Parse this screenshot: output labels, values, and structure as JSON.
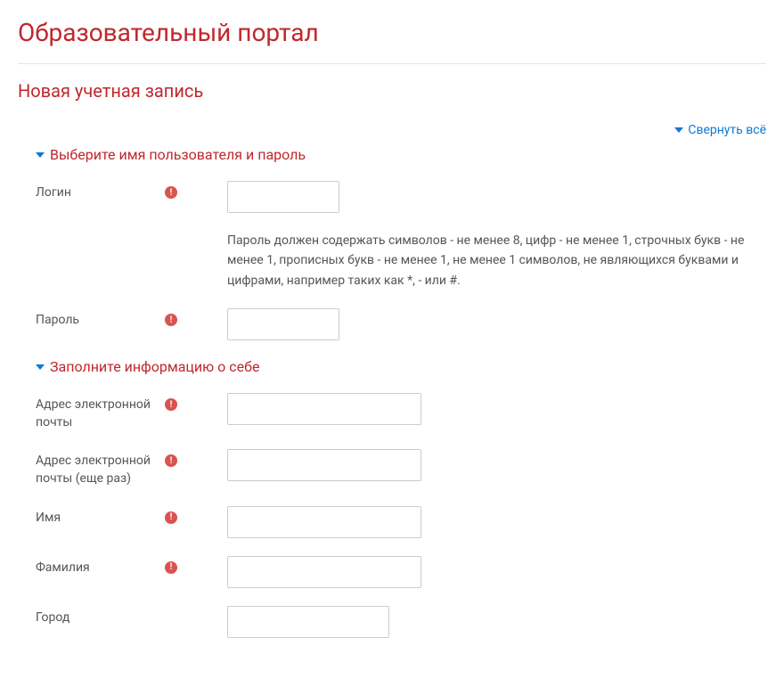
{
  "portal_title": "Образовательный портал",
  "page_title": "Новая учетная запись",
  "collapse_all_label": "Свернуть всё",
  "sections": {
    "credentials": {
      "title": "Выберите имя пользователя и пароль",
      "fields": {
        "login": {
          "label": "Логин",
          "value": ""
        },
        "password": {
          "label": "Пароль",
          "value": ""
        }
      },
      "password_help": "Пароль должен содержать символов - не менее 8, цифр - не менее 1, строчных букв - не менее 1, прописных букв - не менее 1, не менее 1 символов, не являющихся буквами и цифрами, например таких как *, - или #."
    },
    "personal": {
      "title": "Заполните информацию о себе",
      "fields": {
        "email": {
          "label": "Адрес электронной почты",
          "value": ""
        },
        "email_confirm": {
          "label": "Адрес электронной почты (еще раз)",
          "value": ""
        },
        "firstname": {
          "label": "Имя",
          "value": ""
        },
        "lastname": {
          "label": "Фамилия",
          "value": ""
        },
        "city": {
          "label": "Город",
          "value": ""
        }
      }
    }
  }
}
